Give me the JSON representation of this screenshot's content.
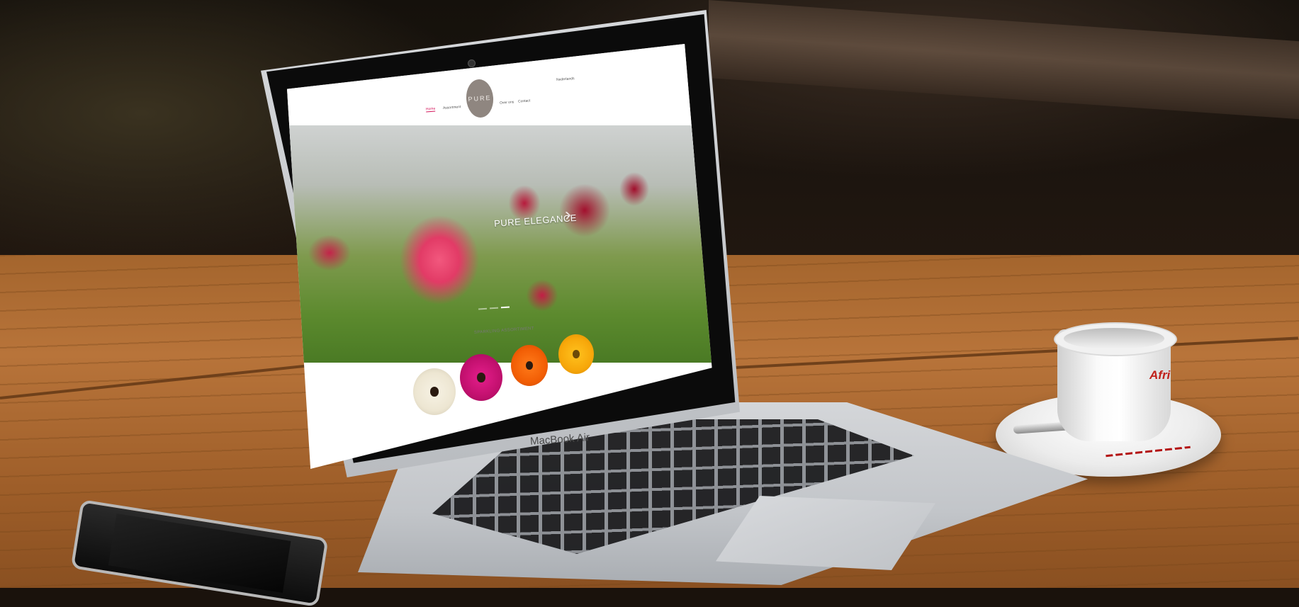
{
  "device": {
    "lid_label": "MacBook Air"
  },
  "website": {
    "logo_text": "PURE",
    "nav": {
      "home": "Home",
      "assortment": "Assortment",
      "over_ons": "Over ons",
      "contact": "Contact",
      "language": "Nederlands"
    },
    "hero": {
      "title": "PURE ELEGANCE",
      "arrow": "›"
    },
    "section": {
      "title": "SPARKLING ASSORTIMENT"
    },
    "assortment_colors": [
      "#f3ecdb",
      "#c9107a",
      "#f46409",
      "#f9b011"
    ]
  },
  "cup": {
    "brand_text": "Afri"
  },
  "colors": {
    "accent": "#d4145a",
    "logo_bg": "#8f8680"
  }
}
